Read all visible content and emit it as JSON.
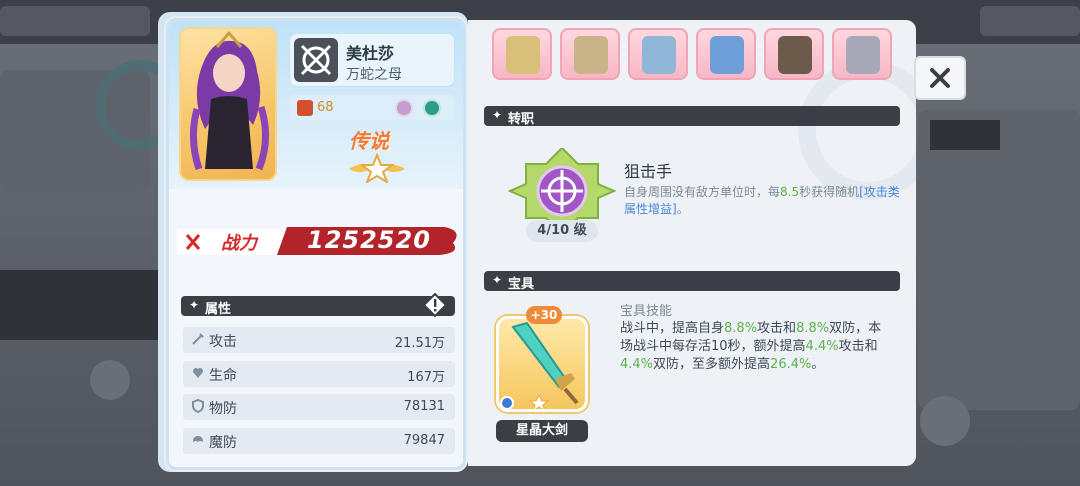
{
  "hero": {
    "name": "美杜莎",
    "title": "万蛇之母",
    "level": "68",
    "rarity": "传说"
  },
  "power": {
    "label": "战力",
    "value": "1252520"
  },
  "attributes": {
    "header": "属性",
    "rows": [
      {
        "name": "攻击",
        "value": "21.51万",
        "icon": "sword-icon"
      },
      {
        "name": "生命",
        "value": "167万",
        "icon": "heart-icon"
      },
      {
        "name": "物防",
        "value": "78131",
        "icon": "shield-icon"
      },
      {
        "name": "魔防",
        "value": "79847",
        "icon": "magic-shield-icon"
      }
    ]
  },
  "job": {
    "header": "转职",
    "name": "狙击手",
    "level": "4/10 级",
    "desc_parts": [
      "自身周围没有敌方单位时，每",
      "8.5",
      "秒获得随机",
      "[攻击类属性增益]",
      "。"
    ]
  },
  "relic": {
    "header": "宝具",
    "name": "星晶大剑",
    "plus": "+30",
    "skill_title": "宝具技能",
    "desc_parts": [
      "战斗中，提高自身",
      "8.8%",
      "攻击和",
      "8.8%",
      "双防，本场战斗中每存活10秒，额外提高",
      "4.4%",
      "攻击和",
      "4.4%",
      "双防，至多额外提高",
      "26.4%",
      "。"
    ]
  },
  "colors": {
    "accent_green": "#5ab34a",
    "accent_blue": "#4a86d8",
    "power_red": "#d9282c",
    "section_dark": "#3b3f45"
  }
}
